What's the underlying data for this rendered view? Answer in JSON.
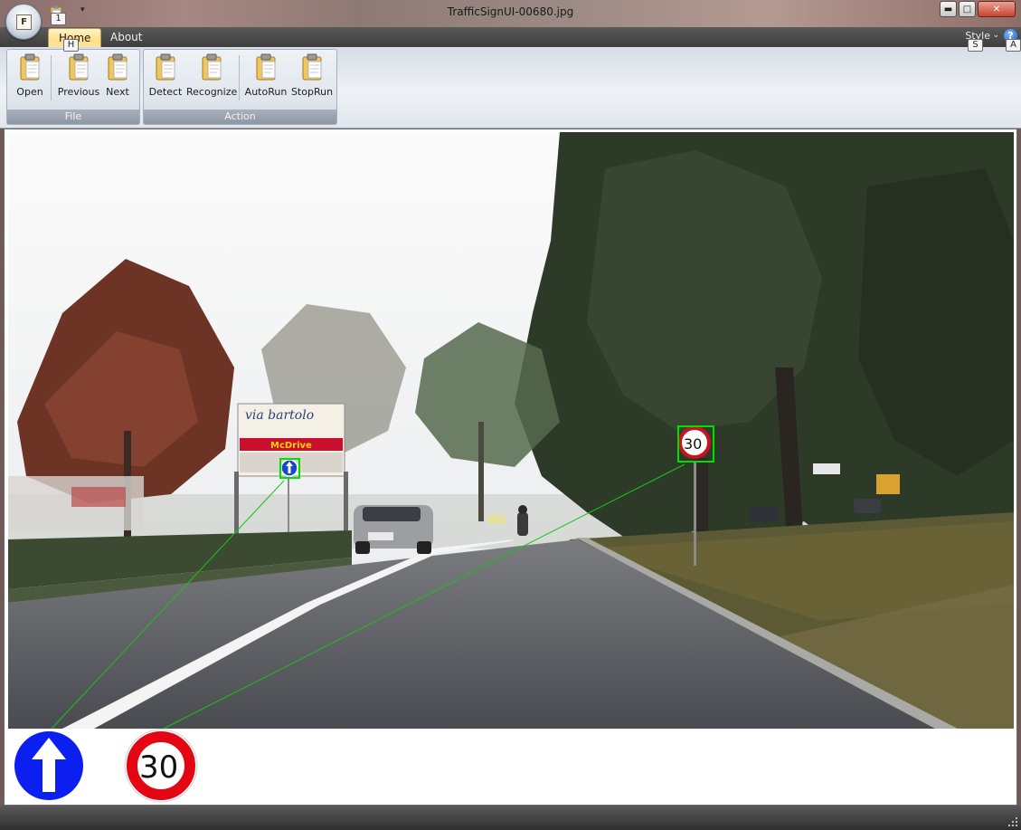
{
  "window": {
    "title": "TrafficSignUI-00680.jpg",
    "minimize_glyph": "▬",
    "maximize_glyph": "□",
    "close_glyph": "✕"
  },
  "app_menu": {
    "orb_letter": "F",
    "quick_access_keytip": "1",
    "icon": "clipboard-icon"
  },
  "tabs": [
    {
      "label": "Home",
      "keytip": "H",
      "active": true
    },
    {
      "label": "About",
      "active": false
    }
  ],
  "style_menu": {
    "label": "Style",
    "keytip": "S",
    "chevron": "⌄"
  },
  "help": {
    "glyph": "?",
    "keytip": "A"
  },
  "ribbon": {
    "groups": [
      {
        "label": "File",
        "buttons": [
          {
            "label": "Open",
            "icon": "clipboard-icon"
          },
          {
            "label": "Previous",
            "icon": "clipboard-icon"
          },
          {
            "label": "Next",
            "icon": "clipboard-icon"
          }
        ]
      },
      {
        "label": "Action",
        "buttons": [
          {
            "label": "Detect",
            "icon": "clipboard-icon"
          },
          {
            "label": "Recognize",
            "icon": "clipboard-icon"
          },
          {
            "label": "AutoRun",
            "icon": "clipboard-icon"
          },
          {
            "label": "StopRun",
            "icon": "clipboard-icon"
          }
        ]
      }
    ]
  },
  "scene": {
    "billboard_text_1": "via bartolo",
    "billboard_text_2": "McDrive",
    "sign_speed_value": "30",
    "detections": [
      {
        "sign": "mandatory-straight-ahead",
        "color": "#00e000"
      },
      {
        "sign": "speed-limit-30",
        "color": "#00e000"
      }
    ]
  },
  "recognized_signs": [
    {
      "type": "mandatory-straight-ahead",
      "color": "#0a1ff0"
    },
    {
      "type": "speed-limit",
      "value": "30",
      "color": "#e30613"
    }
  ],
  "colors": {
    "ribbon_tab_active": "#ffe089",
    "detection_box": "#00e000",
    "status_bar": "#3d3d3d"
  }
}
